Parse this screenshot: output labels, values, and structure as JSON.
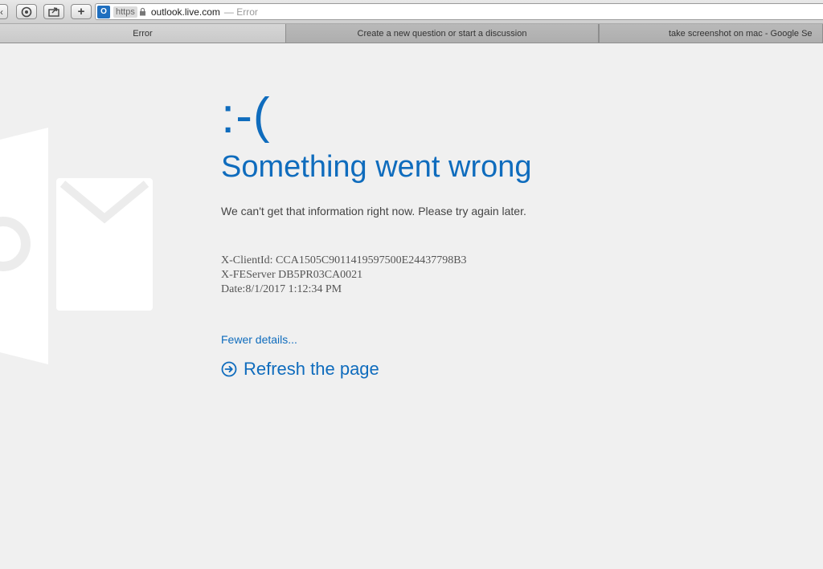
{
  "browser": {
    "address": {
      "scheme_badge": "https",
      "url": "outlook.live.com",
      "title_suffix": "— Error"
    },
    "tabs": [
      {
        "label": "Error"
      },
      {
        "label": "Create a new question or start a discussion"
      },
      {
        "label": "take screenshot on mac - Google Se"
      }
    ]
  },
  "error_page": {
    "emoticon": ":-(",
    "title": "Something went wrong",
    "message": "We can't get that information right now. Please try again later.",
    "details": {
      "client_id": "X-ClientId: CCA1505C9011419597500E24437798B3",
      "fe_server": "X-FEServer DB5PR03CA0021",
      "date": "Date:8/1/2017 1:12:34 PM"
    },
    "fewer_details_link": "Fewer details...",
    "refresh_link": "Refresh the page"
  },
  "colors": {
    "accent": "#0f6cbd",
    "background": "#f0f0f0",
    "logo_watermark": "#ffffff"
  }
}
